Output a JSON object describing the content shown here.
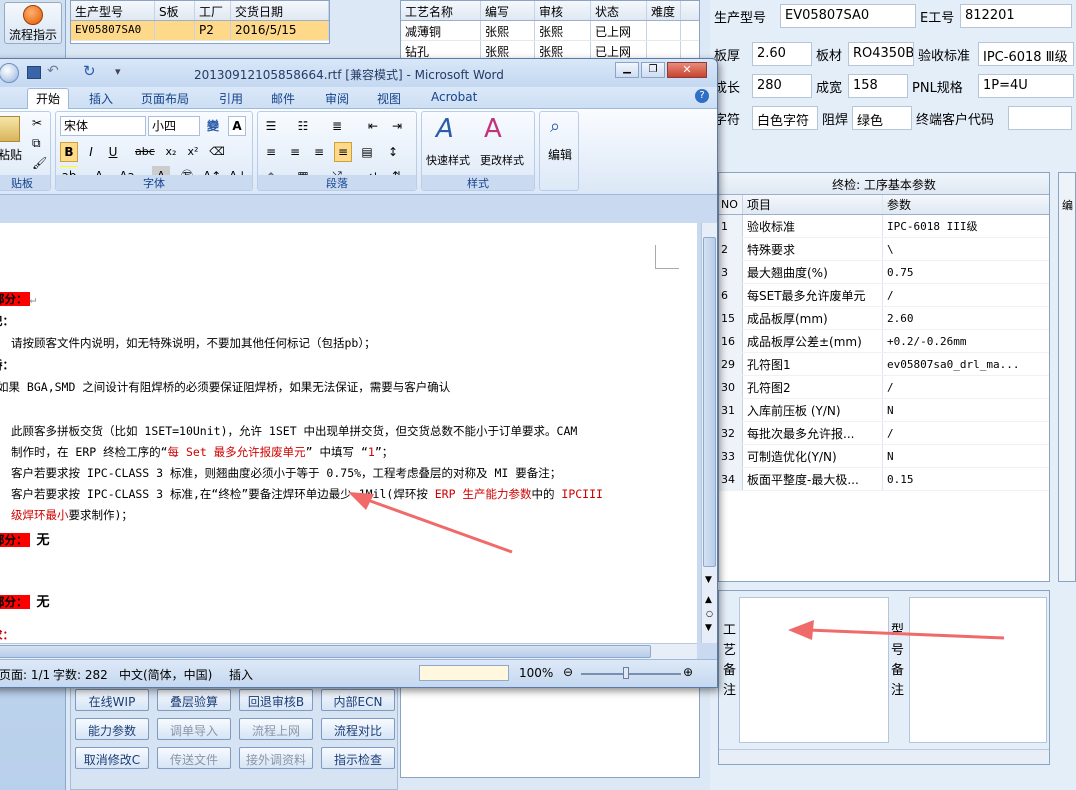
{
  "left": {
    "flow_label": "流程指示"
  },
  "order_grid": {
    "headers": [
      "生产型号",
      "S板",
      "工厂",
      "交货日期"
    ],
    "rows": [
      [
        "EV05807SA0",
        "",
        "P2",
        "2016/5/15"
      ]
    ]
  },
  "process_grid": {
    "headers": [
      "工艺名称",
      "编写",
      "审核",
      "状态",
      "难度"
    ],
    "rows": [
      [
        "减薄铜",
        "张熙",
        "张熙",
        "已上网",
        ""
      ],
      [
        "钻孔",
        "张熙",
        "张熙",
        "已上网",
        ""
      ]
    ]
  },
  "right": {
    "fields": [
      {
        "label": "生产型号",
        "value": "EV05807SA0"
      },
      {
        "label": "E工号",
        "value": "812201"
      },
      {
        "label": "板厚",
        "value": "2.60"
      },
      {
        "label": "板材",
        "value": "RO4350B"
      },
      {
        "label": "验收标准",
        "value": "IPC-6018 Ⅲ级"
      },
      {
        "label": "成长",
        "value": "280"
      },
      {
        "label": "成宽",
        "value": "158"
      },
      {
        "label": "PNL规格",
        "value": "1P=4U"
      },
      {
        "label": "字符",
        "value": "白色字符"
      },
      {
        "label": "阻焊",
        "value": "绿色"
      },
      {
        "label": "终端客户代码",
        "value": ""
      }
    ],
    "params_title": "终检: 工序基本参数",
    "params_headers": [
      "NO",
      "项目",
      "参数"
    ],
    "params": [
      [
        "1",
        "验收标准",
        "IPC-6018 III级"
      ],
      [
        "2",
        "特殊要求",
        "\\"
      ],
      [
        "3",
        "最大翘曲度(%)",
        "0.75"
      ],
      [
        "6",
        "每SET最多允许废单元",
        "/"
      ],
      [
        "15",
        "成品板厚(mm)",
        "2.60"
      ],
      [
        "16",
        "成品板厚公差±(mm)",
        "+0.2/-0.26mm"
      ],
      [
        "29",
        "孔符图1",
        "ev05807sa0_drl_ma..."
      ],
      [
        "30",
        "孔符图2",
        "/"
      ],
      [
        "31",
        "入库前压板 (Y/N)",
        "N"
      ],
      [
        "32",
        "每批次最多允许报...",
        "/"
      ],
      [
        "33",
        "可制造优化(Y/N)",
        "N"
      ],
      [
        "34",
        "板面平整度-最大极...",
        "0.15"
      ]
    ],
    "craft_note_label": "工艺备注",
    "model_note_label": "型号备注",
    "side_label": "编"
  },
  "buttons": {
    "row1": [
      "在线WIP",
      "叠层验算",
      "回退审核B",
      "内部ECN"
    ],
    "row2": [
      "能力参数",
      "调单导入",
      "流程上网",
      "流程对比"
    ],
    "row3": [
      "取消修改C",
      "传送文件",
      "接外调资料",
      "指示检查"
    ]
  },
  "word": {
    "title": "20130912105858664.rtf [兼容模式] - Microsoft Word",
    "tabs": [
      "开始",
      "插入",
      "页面布局",
      "引用",
      "邮件",
      "审阅",
      "视图",
      "Acrobat"
    ],
    "font_name": "宋体",
    "font_size": "小四",
    "groups": {
      "clipboard": "贴板",
      "paste": "粘贴",
      "font": "字体",
      "paragraph": "段落",
      "styles": "样式",
      "quick_style": "快速样式",
      "change_style": "更改样式",
      "edit": "编辑"
    },
    "doc": {
      "l1": "部分：",
      "l2": "记：",
      "l3": "请按顾客文件内说明，如无特殊说明，不要加其他任何标记（包括pb）；",
      "l4": "桥：",
      "l5": "如果 BGA,SMD 之间设计有阻焊桥的必须要保证阻焊桥，如果无法保证，需要与客户确认",
      "l6": "：",
      "l7": "此顾客多拼板交货（比如 1SET=10Unit)，允许 1SET 中出现单拼交货，但交货总数不能小于订单要求。CAM",
      "l8a": "制作时，在 ERP 终检工序的“",
      "l8b": "每 Set 最多允许报废单元",
      "l8c": "” 中填写 “",
      "l8d": "1",
      "l8e": "”；",
      "l9": "客户若要求按 IPC-CLASS 3 标准，则翘曲度必须小于等于 0.75%，工程考虑叠层的对称及 MI 要备注；",
      "l10a": "客户若要求按 IPC-CLASS 3 标准,在“终检”要备注焊环单边最少 1Mil(焊环按 ",
      "l10b": "ERP 生产能力参数",
      "l10c": "中的 ",
      "l10d": "IPCIII",
      "l11a": "级焊环最小",
      "l11b": "要求制作)；",
      "l12a": "部分：",
      "l12b": "无",
      "l13a": "部分：",
      "l13b": "无",
      "l14": "求："
    },
    "status": {
      "page": "页面: 1/1",
      "words": "字数: 282",
      "lang": "中文(简体，中国)",
      "mode": "插入",
      "zoom": "100%"
    }
  }
}
